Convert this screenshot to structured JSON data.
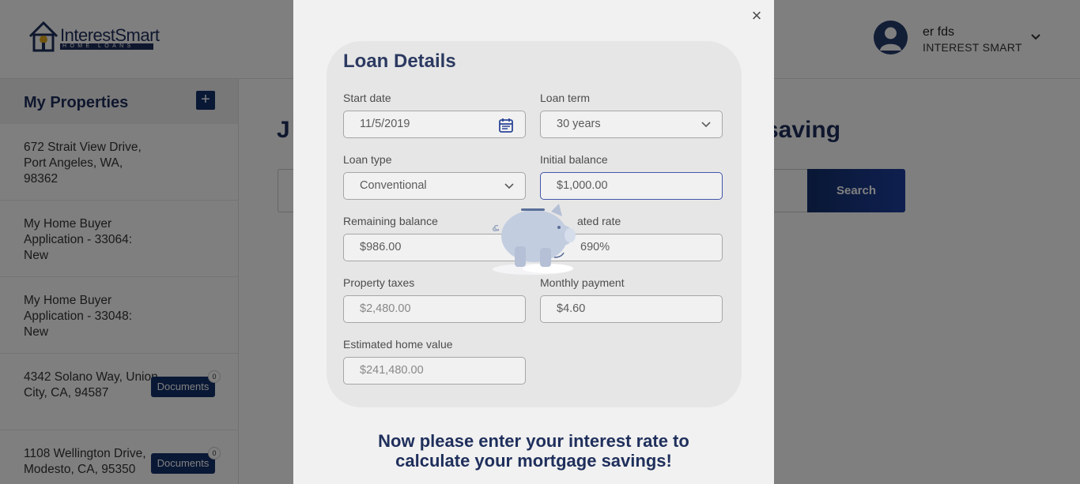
{
  "header": {
    "logo_brand": "InterestSmart",
    "logo_sub": "HOME LOANS",
    "user_name": "er fds",
    "user_org": "INTEREST SMART"
  },
  "sidebar": {
    "title": "My Properties",
    "add_label": "+",
    "properties": [
      {
        "text": "672 Strait View Drive, Port Angeles, WA, 98362"
      },
      {
        "text": "My Home Buyer Application - 33064: New"
      },
      {
        "text": "My Home Buyer Application - 33048: New"
      },
      {
        "text": "4342 Solano Way, Union City, CA, 94587",
        "documents_label": "Documents",
        "documents_count": "0"
      },
      {
        "text": "1108 Wellington Drive, Modesto, CA, 95350",
        "documents_label": "Documents",
        "documents_count": "0"
      }
    ]
  },
  "main": {
    "heading_left": "J",
    "heading_right": "saving",
    "search_button": "Search"
  },
  "modal": {
    "close_label": "×",
    "title": "Loan Details",
    "fields": {
      "start_date": {
        "label": "Start date",
        "value": "11/5/2019"
      },
      "loan_term": {
        "label": "Loan term",
        "value": "30 years"
      },
      "loan_type": {
        "label": "Loan type",
        "value": "Conventional"
      },
      "initial_balance": {
        "label": "Initial balance",
        "value": "$1,000.00"
      },
      "remaining_balance": {
        "label": "Remaining balance",
        "value": "$986.00"
      },
      "rate": {
        "label": "ated rate",
        "value": "690%"
      },
      "property_taxes": {
        "label": "Property taxes",
        "value": "$2,480.00"
      },
      "monthly_payment": {
        "label": "Monthly payment",
        "value": "$4.60"
      },
      "home_value": {
        "label": "Estimated home value",
        "value": "$241,480.00"
      }
    },
    "prompt_line1": "Now please enter your interest rate to",
    "prompt_line2": "calculate your mortgage savings!"
  },
  "colors": {
    "brand_navy": "#1f2f5c",
    "button_navy": "#13306a",
    "focus_border": "#3a4fb0"
  }
}
